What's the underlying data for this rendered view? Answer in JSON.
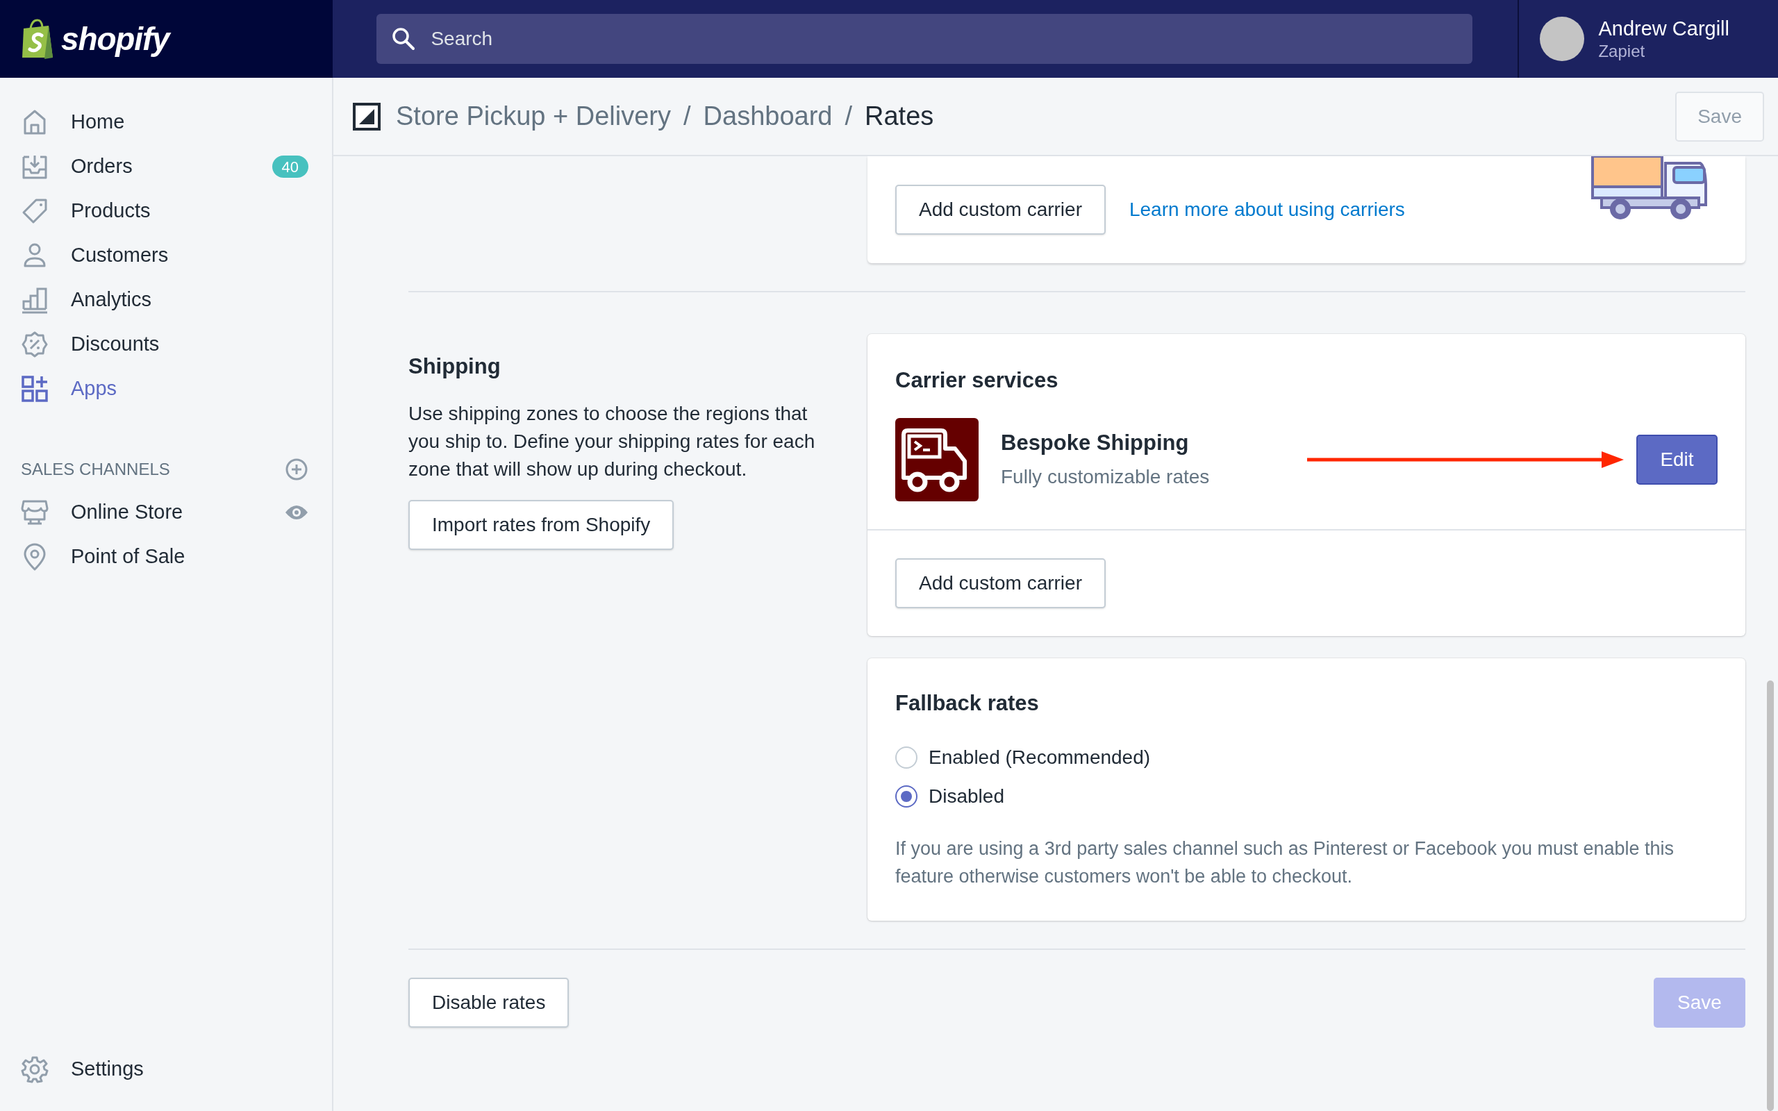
{
  "topbar": {
    "logo_text": "shopify",
    "search": {
      "placeholder": "Search"
    },
    "user": {
      "name": "Andrew Cargill",
      "store": "Zapiet"
    }
  },
  "sidebar": {
    "items": [
      {
        "label": "Home",
        "kind": "home",
        "selected": false
      },
      {
        "label": "Orders",
        "kind": "orders",
        "selected": false,
        "badge": "40"
      },
      {
        "label": "Products",
        "kind": "tag",
        "selected": false
      },
      {
        "label": "Customers",
        "kind": "person",
        "selected": false
      },
      {
        "label": "Analytics",
        "kind": "chart",
        "selected": false
      },
      {
        "label": "Discounts",
        "kind": "discount",
        "selected": false
      },
      {
        "label": "Apps",
        "kind": "apps",
        "selected": true
      }
    ],
    "sales_channels": {
      "heading": "SALES CHANNELS",
      "items": [
        {
          "label": "Online Store",
          "kind": "store"
        },
        {
          "label": "Point of Sale",
          "kind": "pin"
        }
      ]
    },
    "settings": "Settings"
  },
  "header": {
    "breadcrumbs": [
      {
        "label": "Store Pickup + Delivery",
        "current": false
      },
      {
        "label": "Dashboard",
        "current": false
      },
      {
        "label": "Rates",
        "current": true
      }
    ],
    "separator": "/",
    "save": {
      "label": "Save",
      "disabled": true
    }
  },
  "top_card": {
    "button": "Add custom carrier",
    "link": "Learn more about using carriers"
  },
  "shipping": {
    "title": "Shipping",
    "description": "Use shipping zones to choose the regions that you ship to. Define your shipping rates for each zone that will show up during checkout.",
    "button": "Import rates from Shopify"
  },
  "carrier_services": {
    "title": "Carrier services",
    "carriers": [
      {
        "name": "Bespoke Shipping",
        "subtitle": "Fully customizable rates",
        "action": "Edit"
      }
    ],
    "button": "Add custom carrier"
  },
  "fallback_rates": {
    "title": "Fallback rates",
    "options": [
      {
        "label": "Enabled (Recommended)",
        "selected": false
      },
      {
        "label": "Disabled",
        "selected": true
      }
    ],
    "note": "If you are using a 3rd party sales channel such as Pinterest or Facebook you must enable this feature otherwise customers won't be able to checkout."
  },
  "footer": {
    "disable_button": "Disable rates",
    "save": {
      "label": "Save",
      "disabled": true
    }
  }
}
